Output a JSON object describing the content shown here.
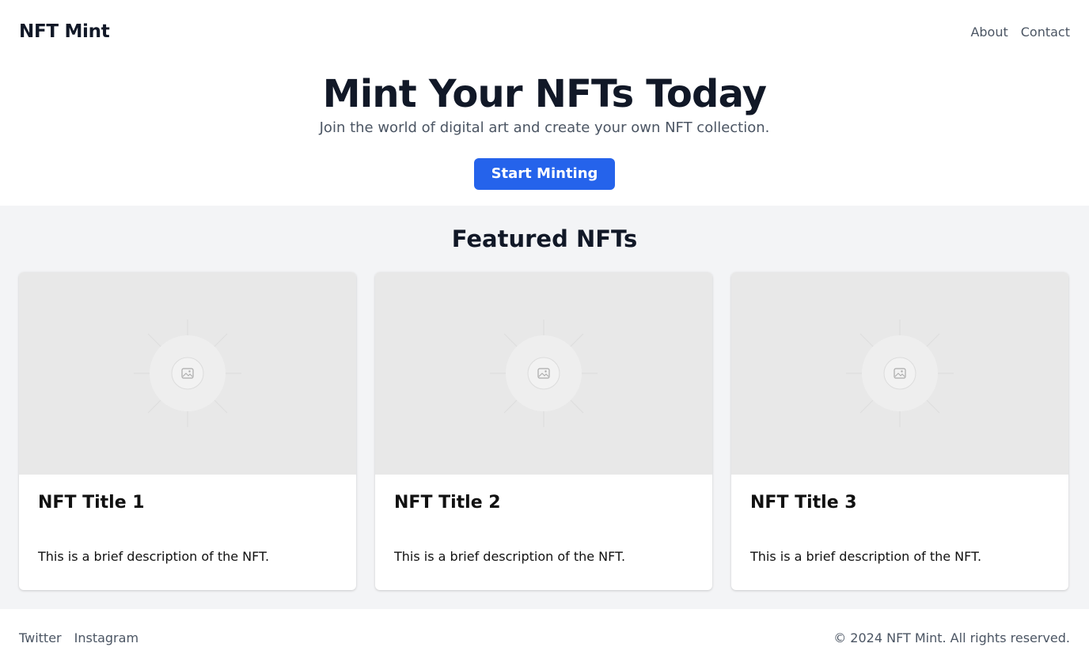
{
  "header": {
    "brand": "NFT Mint",
    "nav": [
      {
        "label": "About"
      },
      {
        "label": "Contact"
      }
    ]
  },
  "hero": {
    "title": "Mint Your NFTs Today",
    "subtitle": "Join the world of digital art and create your own NFT collection.",
    "cta_label": "Start Minting"
  },
  "featured": {
    "heading": "Featured NFTs",
    "cards": [
      {
        "title": "NFT Title 1",
        "description": "This is a brief description of the NFT.",
        "image_icon": "image-placeholder-icon"
      },
      {
        "title": "NFT Title 2",
        "description": "This is a brief description of the NFT.",
        "image_icon": "image-placeholder-icon"
      },
      {
        "title": "NFT Title 3",
        "description": "This is a brief description of the NFT.",
        "image_icon": "image-placeholder-icon"
      }
    ]
  },
  "footer": {
    "links": [
      {
        "label": "Twitter"
      },
      {
        "label": "Instagram"
      }
    ],
    "copyright": "© 2024 NFT Mint. All rights reserved."
  },
  "colors": {
    "accent": "#2563eb",
    "section_bg": "#f3f4f6",
    "text_primary": "#111827",
    "text_muted": "#4b5563"
  }
}
